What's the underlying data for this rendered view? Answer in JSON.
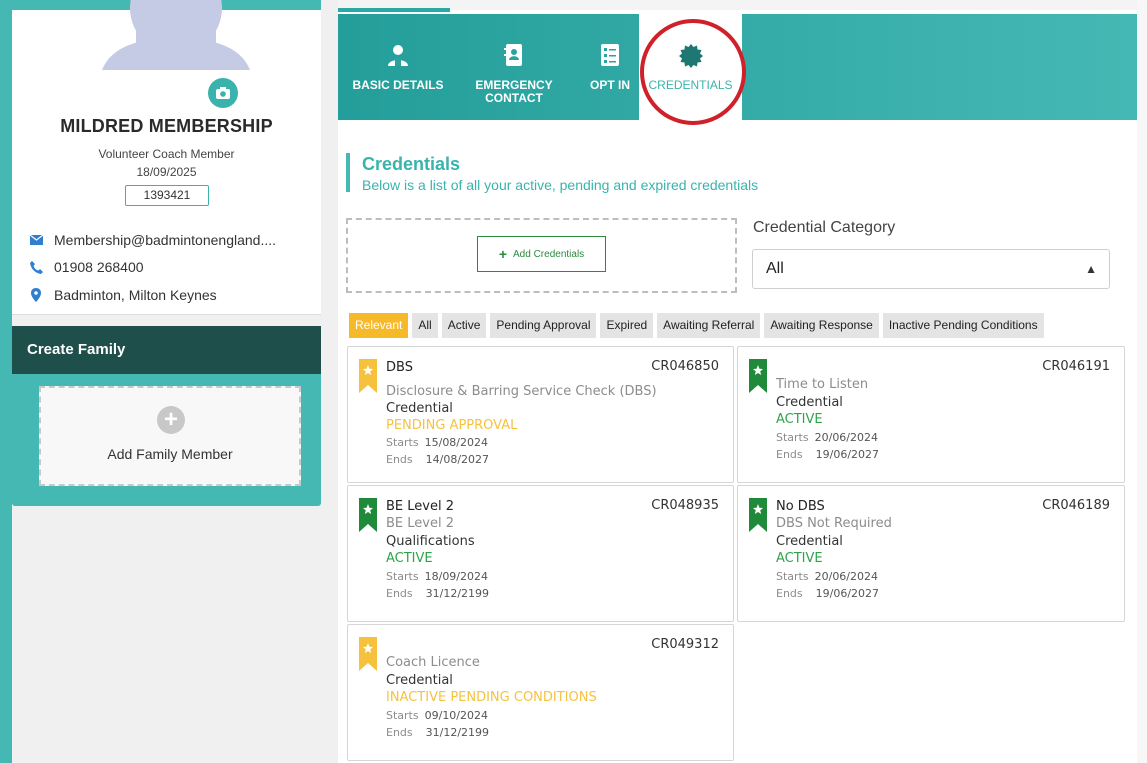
{
  "profile": {
    "name": "MILDRED MEMBERSHIP",
    "role": "Volunteer Coach Member",
    "date": "18/09/2025",
    "member_id": "1393421",
    "email": "Membership@badmintonengland....",
    "phone": "01908 268400",
    "location": "Badminton, Milton Keynes"
  },
  "family": {
    "header": "Create Family",
    "add_label": "Add Family Member"
  },
  "tabs": [
    {
      "label": "BASIC DETAILS",
      "icon": "person-badge-icon"
    },
    {
      "label": "EMERGENCY CONTACT",
      "icon": "contact-book-icon"
    },
    {
      "label": "OPT IN",
      "icon": "checklist-icon"
    },
    {
      "label": "CREDENTIALS",
      "icon": "badge-icon"
    }
  ],
  "section": {
    "title": "Credentials",
    "subtitle": "Below is a list of all your active, pending and expired credentials"
  },
  "add_credentials_label": "Add Credentials",
  "category": {
    "label": "Credential Category",
    "value": "All"
  },
  "filters": [
    "Relevant",
    "All",
    "Active",
    "Pending Approval",
    "Expired",
    "Awaiting Referral",
    "Awaiting Response",
    "Inactive Pending Conditions"
  ],
  "cards": [
    {
      "name": "DBS",
      "code": "CR046850",
      "description": "Disclosure & Barring Service Check (DBS)",
      "category": "Credential",
      "status": "PENDING APPROVAL",
      "starts_label": "Starts",
      "starts": "15/08/2024",
      "ends_label": "Ends",
      "ends": "14/08/2027",
      "ribbon_color": "#f6c23e"
    },
    {
      "name": "",
      "code": "CR046191",
      "description": "Time to Listen",
      "category": "Credential",
      "status": "ACTIVE",
      "starts_label": "Starts",
      "starts": "20/06/2024",
      "ends_label": "Ends",
      "ends": "19/06/2027",
      "ribbon_color": "#1e8a3a"
    },
    {
      "name": "BE Level 2",
      "code": "CR048935",
      "description": "BE Level 2",
      "category": "Qualifications",
      "status": "ACTIVE",
      "starts_label": "Starts",
      "starts": "18/09/2024",
      "ends_label": "Ends",
      "ends": "31/12/2199",
      "ribbon_color": "#1e8a3a"
    },
    {
      "name": "No DBS",
      "code": "CR046189",
      "description": "DBS Not Required",
      "category": "Credential",
      "status": "ACTIVE",
      "starts_label": "Starts",
      "starts": "20/06/2024",
      "ends_label": "Ends",
      "ends": "19/06/2027",
      "ribbon_color": "#1e8a3a"
    },
    {
      "name": "",
      "code": "CR049312",
      "description": "Coach Licence",
      "category": "Credential",
      "status": "INACTIVE PENDING CONDITIONS",
      "starts_label": "Starts",
      "starts": "09/10/2024",
      "ends_label": "Ends",
      "ends": "31/12/2199",
      "ribbon_color": "#f6c23e"
    }
  ],
  "colors": {
    "teal": "#45b8b4",
    "dark_teal": "#1f4f4b",
    "active_green": "#2ea44a",
    "pending_yellow": "#f6c23e",
    "filter_active": "#f6b92a",
    "highlight_red": "#d0202a"
  }
}
